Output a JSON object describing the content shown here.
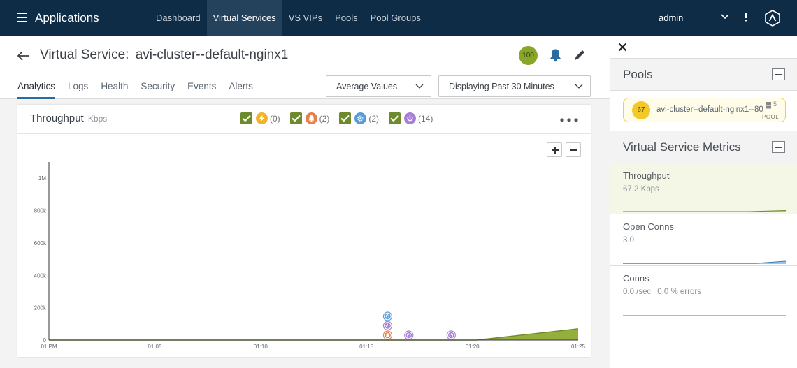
{
  "app": {
    "title": "Applications",
    "user": "admin",
    "nav": [
      "Dashboard",
      "Virtual Services",
      "VS VIPs",
      "Pools",
      "Pool Groups"
    ]
  },
  "header": {
    "title_prefix": "Virtual Service:",
    "vs_name": "avi-cluster--default-nginx1",
    "health_score": "100",
    "tabs": [
      "Analytics",
      "Logs",
      "Health",
      "Security",
      "Events",
      "Alerts"
    ],
    "values_select": "Average Values",
    "time_select": "Displaying Past 30 Minutes"
  },
  "chart_card": {
    "title": "Throughput",
    "unit": "Kbps",
    "legend": [
      {
        "icon": "lightning-icon",
        "color": "#f0b429",
        "count": "(0)"
      },
      {
        "icon": "bell-icon",
        "color": "#e8804a",
        "count": "(2)"
      },
      {
        "icon": "gear-icon",
        "color": "#5b9bd5",
        "count": "(2)"
      },
      {
        "icon": "power-icon",
        "color": "#a77fd6",
        "count": "(14)"
      }
    ]
  },
  "chart_data": {
    "type": "area",
    "y_ticks": [
      "0",
      "200k",
      "400k",
      "600k",
      "800k",
      "1M"
    ],
    "x_ticks": [
      "01 PM",
      "01:05",
      "01:10",
      "01:15",
      "01:20",
      "01:25"
    ],
    "ylim": [
      0,
      1100000
    ],
    "x_minutes": [
      0,
      19,
      20.2,
      25
    ],
    "values": [
      0,
      0,
      0,
      70000
    ],
    "series_color": "#8aa628",
    "events": [
      {
        "type": "bell",
        "minute": 16.0,
        "stack": 0,
        "color": "#e8804a"
      },
      {
        "type": "power",
        "minute": 16.0,
        "stack": 1,
        "color": "#a77fd6"
      },
      {
        "type": "gear",
        "minute": 16.0,
        "stack": 2,
        "color": "#5b9bd5"
      },
      {
        "type": "power",
        "minute": 17.0,
        "stack": 0,
        "color": "#a77fd6"
      },
      {
        "type": "power",
        "minute": 19.0,
        "stack": 0,
        "color": "#a77fd6"
      }
    ]
  },
  "panel": {
    "pools_title": "Pools",
    "pool": {
      "score": "67",
      "name": "avi-cluster--default-nginx1--80",
      "label": "POOL",
      "count": "5"
    },
    "metrics_title": "Virtual Service Metrics",
    "metrics": [
      {
        "name": "Throughput",
        "value": "67.2 Kbps"
      },
      {
        "name": "Open Conns",
        "value": "3.0"
      },
      {
        "name": "Conns",
        "value": "0.0 /sec",
        "errors": "0.0 % errors"
      }
    ]
  }
}
